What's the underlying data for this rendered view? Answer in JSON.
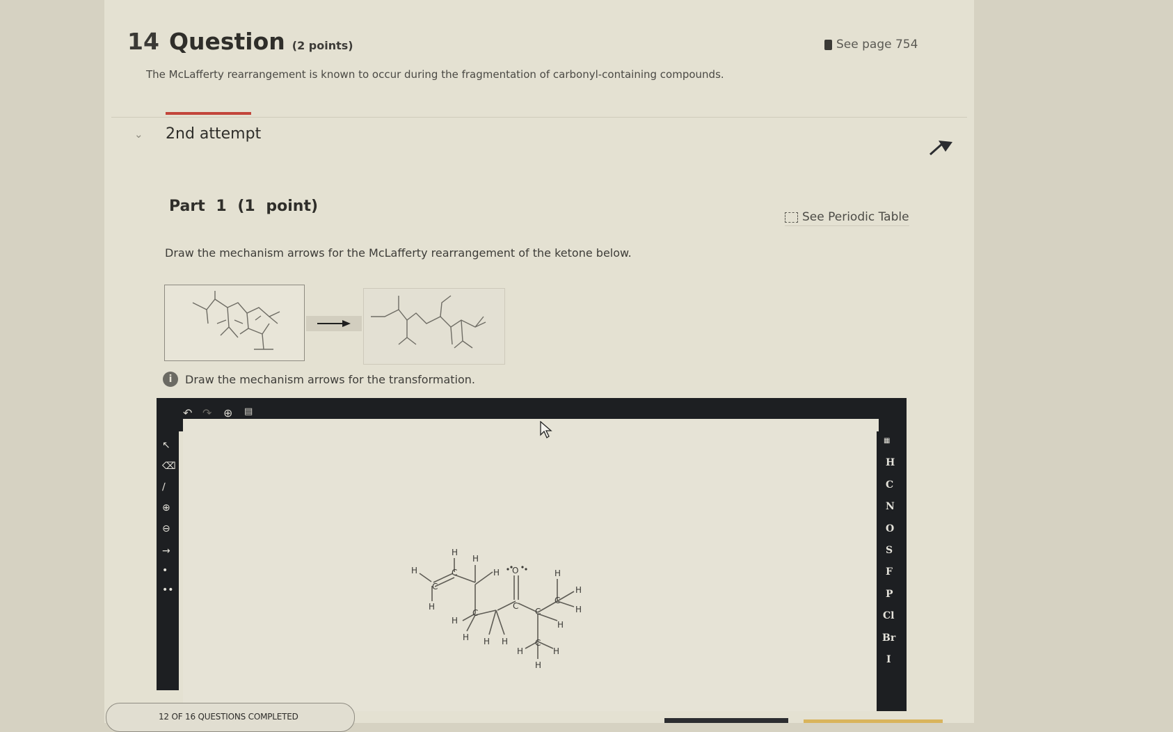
{
  "question": {
    "number": "14",
    "title": "Question",
    "points": "(2 points)",
    "see_page": "See page 754",
    "intro": "The McLafferty rearrangement is known to occur during the fragmentation of carbonyl-containing compounds."
  },
  "attempt": {
    "label": "2nd attempt"
  },
  "part": {
    "title": "Part 1 (1 point)",
    "periodic_link": "See Periodic Table",
    "prompt": "Draw the mechanism arrows for the McLafferty rearrangement of the ketone below."
  },
  "info": {
    "text": "Draw the mechanism arrows for the transformation."
  },
  "editor": {
    "elements": [
      "H",
      "C",
      "N",
      "O",
      "S",
      "F",
      "P",
      "Cl",
      "Br",
      "I"
    ]
  },
  "footer": {
    "progress": "12 OF 16 QUESTIONS COMPLETED"
  },
  "colors": {
    "accent": "#c2453a",
    "toolbar": "#1d1f22",
    "background": "#e4e1d2"
  }
}
